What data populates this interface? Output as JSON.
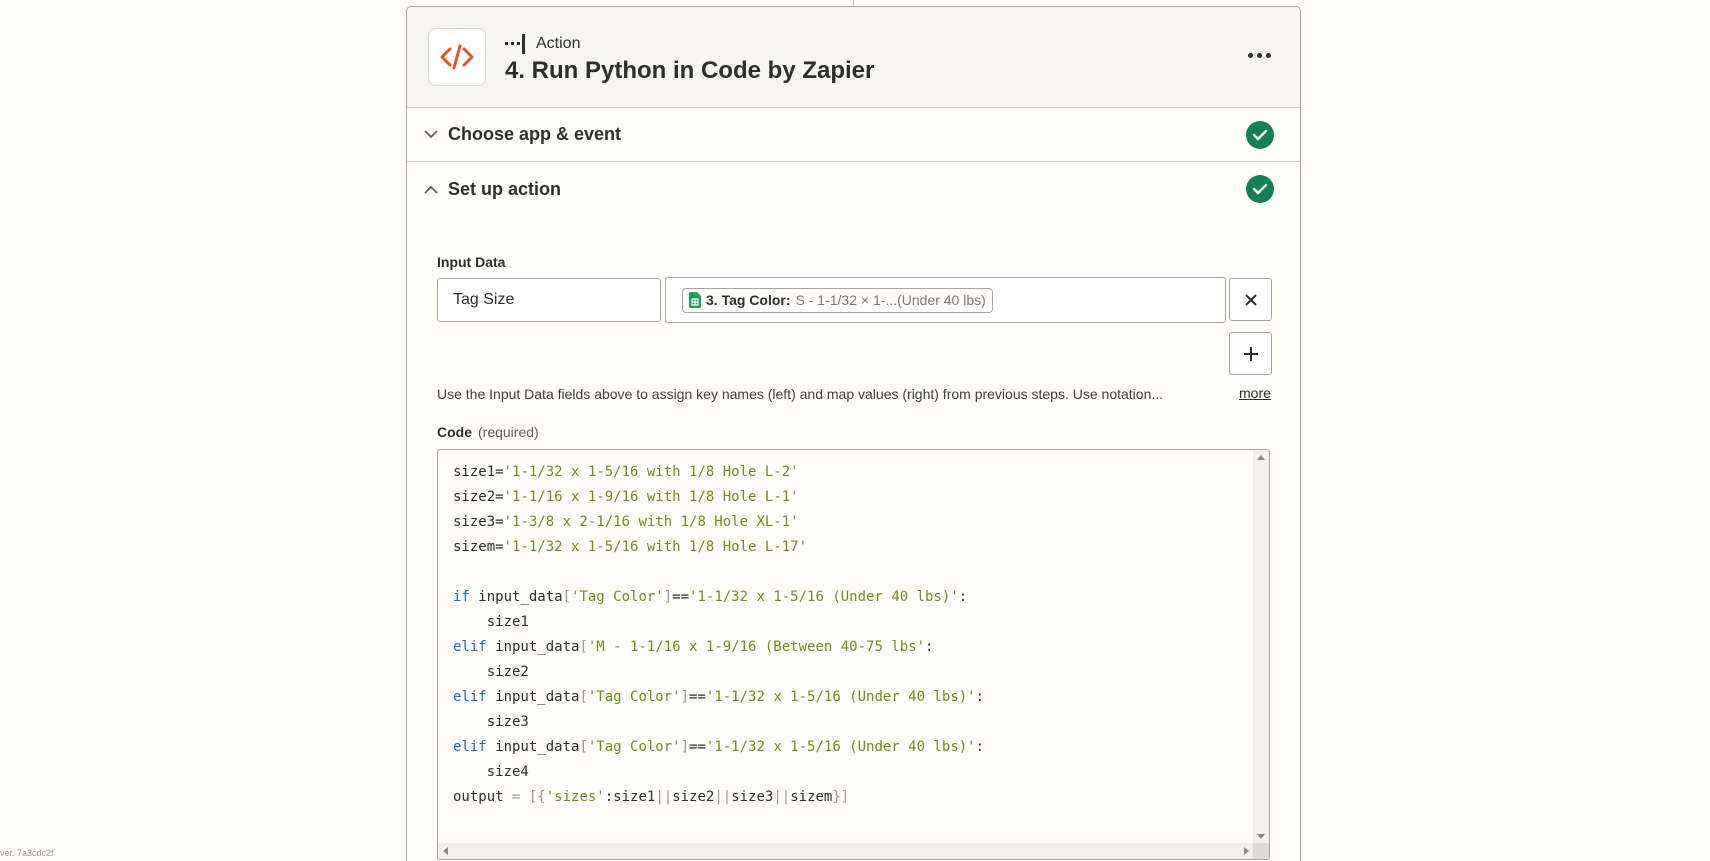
{
  "header": {
    "action_label": "Action",
    "step_title": "4. Run Python in Code by Zapier",
    "app_icon": "code-icon",
    "brand_color": "#e8512a"
  },
  "sections": [
    {
      "label": "Choose app & event",
      "expanded": false,
      "complete": true
    },
    {
      "label": "Set up action",
      "expanded": true,
      "complete": true
    }
  ],
  "input_data": {
    "label": "Input Data",
    "key": "Tag Size",
    "value_pill": {
      "key": "3. Tag Color:",
      "value": "S - 1-1/32 × 1-...(Under 40 lbs)",
      "icon": "google-sheets-icon"
    },
    "help_text": "Use the Input Data fields above to assign key names (left) and map values (right) from previous steps. Use notation...",
    "more_link": "more"
  },
  "code": {
    "label": "Code",
    "required_label": "(required)",
    "lines": [
      [
        {
          "t": "size1="
        },
        {
          "c": "str",
          "t": "'1-1/32 x 1-5/16 with 1/8 Hole L-2'"
        }
      ],
      [
        {
          "t": "size2="
        },
        {
          "c": "str",
          "t": "'1-1/16 x 1-9/16 with 1/8 Hole L-1'"
        }
      ],
      [
        {
          "t": "size3="
        },
        {
          "c": "str",
          "t": "'1-3/8 x 2-1/16 with 1/8 Hole XL-1'"
        }
      ],
      [
        {
          "t": "sizem="
        },
        {
          "c": "str",
          "t": "'1-1/32 x 1-5/16 with 1/8 Hole L-17'"
        }
      ],
      [],
      [
        {
          "c": "kw",
          "t": "if"
        },
        {
          "t": " input_data"
        },
        {
          "c": "op",
          "t": "["
        },
        {
          "c": "str",
          "t": "'Tag Color'"
        },
        {
          "c": "op",
          "t": "]"
        },
        {
          "t": "=="
        },
        {
          "c": "str",
          "t": "'1-1/32 x 1-5/16 (Under 40 lbs)'"
        },
        {
          "t": ":"
        }
      ],
      [
        {
          "t": "    size1"
        }
      ],
      [
        {
          "c": "kw",
          "t": "elif"
        },
        {
          "t": " input_data"
        },
        {
          "c": "op",
          "t": "["
        },
        {
          "c": "str",
          "t": "'M - 1-1/16 x 1-9/16 (Between 40-75 lbs'"
        },
        {
          "t": ":"
        }
      ],
      [
        {
          "t": "    size2"
        }
      ],
      [
        {
          "c": "kw",
          "t": "elif"
        },
        {
          "t": " input_data"
        },
        {
          "c": "op",
          "t": "["
        },
        {
          "c": "str",
          "t": "'Tag Color'"
        },
        {
          "c": "op",
          "t": "]"
        },
        {
          "t": "=="
        },
        {
          "c": "str",
          "t": "'1-1/32 x 1-5/16 (Under 40 lbs)'"
        },
        {
          "t": ":"
        }
      ],
      [
        {
          "t": "    size3"
        }
      ],
      [
        {
          "c": "kw",
          "t": "elif"
        },
        {
          "t": " input_data"
        },
        {
          "c": "op",
          "t": "["
        },
        {
          "c": "str",
          "t": "'Tag Color'"
        },
        {
          "c": "op",
          "t": "]"
        },
        {
          "t": "=="
        },
        {
          "c": "str",
          "t": "'1-1/32 x 1-5/16 (Under 40 lbs)'"
        },
        {
          "t": ":"
        }
      ],
      [
        {
          "t": "    size4"
        }
      ],
      [
        {
          "t": "output "
        },
        {
          "c": "op",
          "t": "= [{"
        },
        {
          "c": "str",
          "t": "'sizes'"
        },
        {
          "t": ":size1"
        },
        {
          "c": "op",
          "t": "||"
        },
        {
          "t": "size2"
        },
        {
          "c": "op",
          "t": "||"
        },
        {
          "t": "size3"
        },
        {
          "c": "op",
          "t": "||"
        },
        {
          "t": "sizem"
        },
        {
          "c": "op",
          "t": "}]"
        }
      ]
    ]
  },
  "footer": {
    "version": "ver. 7a3cdc2f"
  },
  "colors": {
    "success": "#148155",
    "keyword": "#2c6aa4",
    "string": "#6c8e1d"
  }
}
